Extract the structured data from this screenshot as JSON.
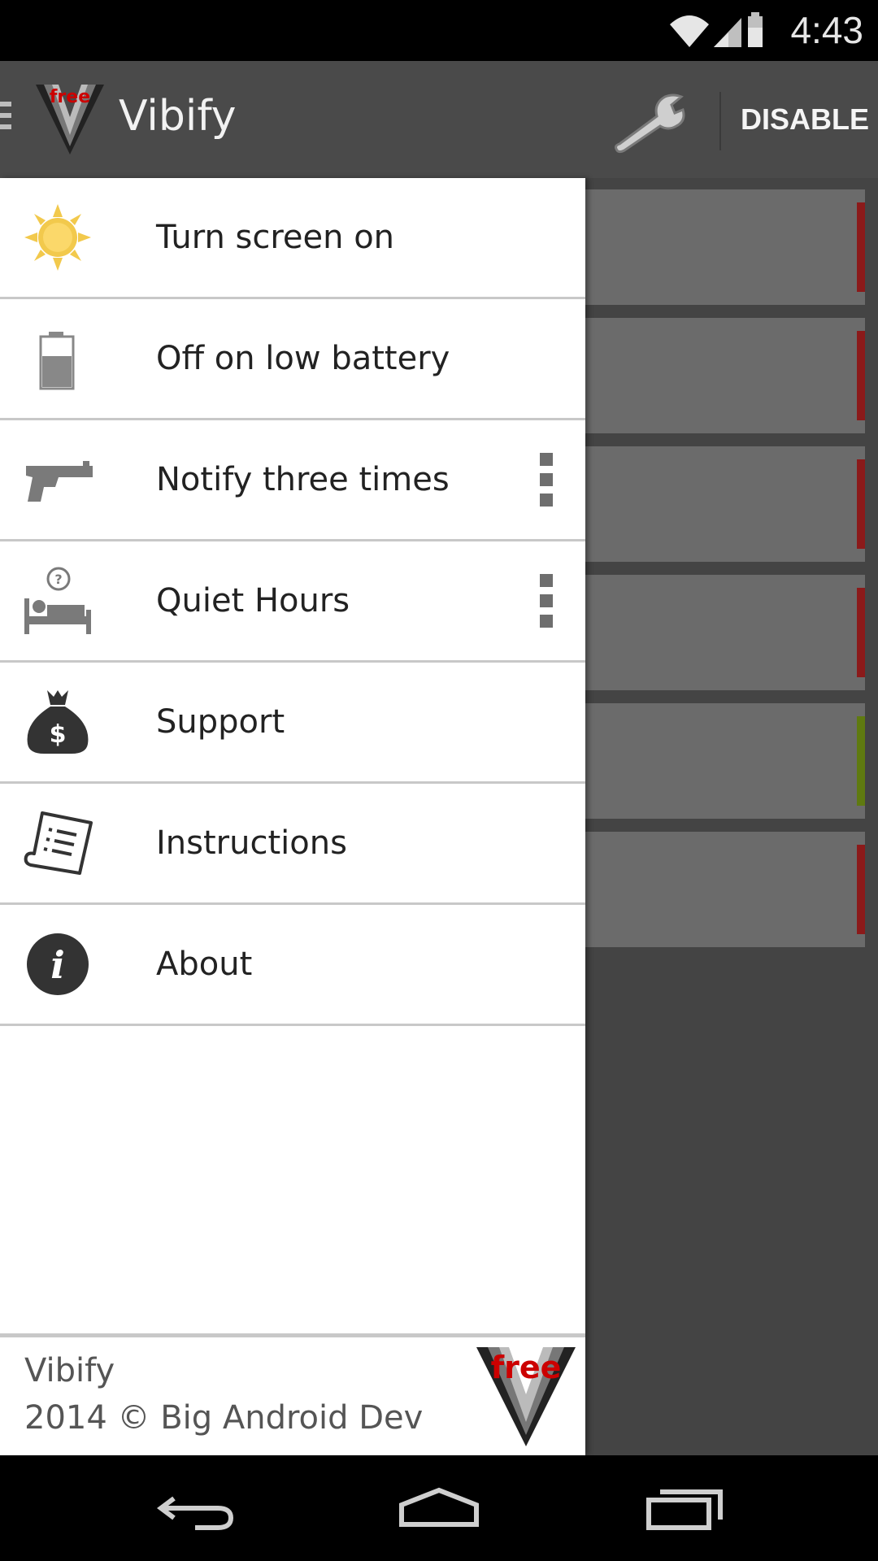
{
  "status": {
    "time": "4:43"
  },
  "appbar": {
    "title": "Vibify",
    "disable_label": "DISABLE",
    "logo_text": "free"
  },
  "drawer": {
    "items": [
      {
        "label": "Turn screen on",
        "icon": "sun-icon"
      },
      {
        "label": "Off on low battery",
        "icon": "battery-icon"
      },
      {
        "label": "Notify three times",
        "icon": "gun-icon",
        "has_menu": true
      },
      {
        "label": "Quiet Hours",
        "icon": "sleep-bed-icon",
        "has_menu": true
      },
      {
        "label": "Support",
        "icon": "money-bag-icon"
      },
      {
        "label": "Instructions",
        "icon": "document-icon"
      },
      {
        "label": "About",
        "icon": "info-icon"
      }
    ],
    "footer": {
      "app_name": "Vibify",
      "copyright": "2014 © Big Android Dev"
    }
  },
  "background_cards": {
    "indicator_colors": [
      "#8b1a1a",
      "#8b1a1a",
      "#8b1a1a",
      "#8b1a1a",
      "#5f7a10",
      "#8b1a1a"
    ]
  },
  "colors": {
    "appbar": "#4a4a4a",
    "drawer": "#ffffff",
    "content": "#444444",
    "logo_accent": "#cc0000"
  }
}
